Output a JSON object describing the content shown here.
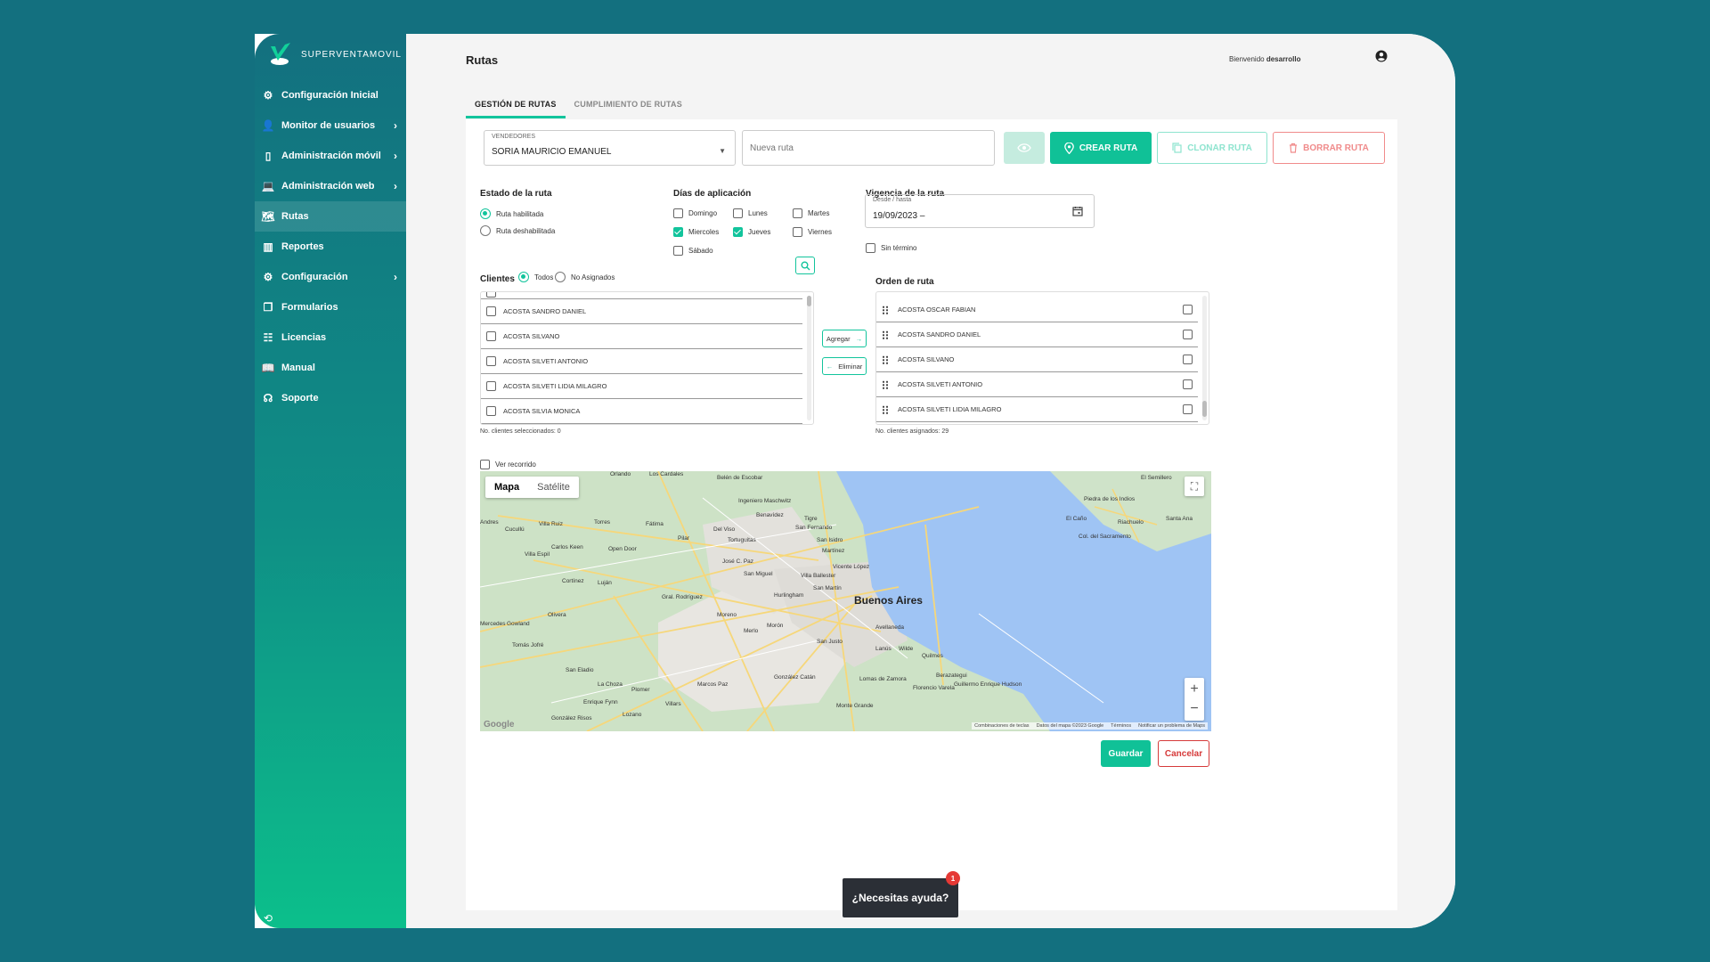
{
  "brand": {
    "name": "SUPERVENTAMOVIL"
  },
  "sidebar": {
    "items": [
      {
        "label": "Configuración Inicial",
        "icon": "gear-icon",
        "chevron": false
      },
      {
        "label": "Monitor de usuarios",
        "icon": "person-icon",
        "chevron": true
      },
      {
        "label": "Administración móvil",
        "icon": "phone-icon",
        "chevron": true
      },
      {
        "label": "Administración web",
        "icon": "laptop-icon",
        "chevron": true
      },
      {
        "label": "Rutas",
        "icon": "map-icon",
        "chevron": false
      },
      {
        "label": "Reportes",
        "icon": "chart-icon",
        "chevron": false
      },
      {
        "label": "Configuración",
        "icon": "gear-icon",
        "chevron": true
      },
      {
        "label": "Formularios",
        "icon": "forms-icon",
        "chevron": false
      },
      {
        "label": "Licencias",
        "icon": "license-icon",
        "chevron": false
      },
      {
        "label": "Manual",
        "icon": "book-icon",
        "chevron": false
      },
      {
        "label": "Soporte",
        "icon": "headset-icon",
        "chevron": false
      }
    ],
    "active": "Rutas"
  },
  "header": {
    "title": "Rutas",
    "welcome_prefix": "Bienvenido",
    "welcome_user": "desarrollo"
  },
  "tabs": [
    {
      "label": "GESTIÓN DE RUTAS",
      "active": true
    },
    {
      "label": "CUMPLIMIENTO DE RUTAS",
      "active": false
    }
  ],
  "form": {
    "seller_label": "VENDEDORES",
    "seller_value": "SORIA MAURICIO EMANUEL",
    "route_name_placeholder": "Nueva ruta",
    "create_label": "CREAR RUTA",
    "clone_label": "CLONAR RUTA",
    "delete_label": "BORRAR RUTA",
    "status_title": "Estado de la ruta",
    "status_enabled": "Ruta habilitada",
    "status_disabled": "Ruta deshabilitada",
    "days_title": "Días de aplicación",
    "days": [
      {
        "label": "Domingo",
        "checked": false
      },
      {
        "label": "Lunes",
        "checked": false
      },
      {
        "label": "Martes",
        "checked": false
      },
      {
        "label": "Miercoles",
        "checked": true
      },
      {
        "label": "Jueves",
        "checked": true
      },
      {
        "label": "Viernes",
        "checked": false
      },
      {
        "label": "Sábado",
        "checked": false
      }
    ],
    "validity_title": "Vigencia de la ruta",
    "date_label": "Desde / hasta",
    "date_value": "19/09/2023 –",
    "no_end_label": "Sin término"
  },
  "clients": {
    "title": "Clientes",
    "filter_all": "Todos",
    "filter_unassigned": "No Asignados",
    "rows": [
      "ACOSTA SANDRO DANIEL",
      "ACOSTA SILVANO",
      "ACOSTA SILVETI ANTONIO",
      "ACOSTA SILVETI LIDIA MILAGRO",
      "ACOSTA SILVIA MONICA"
    ],
    "selected_note": "No. clientes seleccionados: 0"
  },
  "transfer": {
    "add_label": "Agregar",
    "remove_label": "Eliminar"
  },
  "route_order": {
    "title": "Orden de ruta",
    "rows": [
      "ACOSTA OSCAR FABIAN",
      "ACOSTA SANDRO DANIEL",
      "ACOSTA SILVANO",
      "ACOSTA SILVETI ANTONIO",
      "ACOSTA SILVETI LIDIA MILAGRO"
    ],
    "assigned_note": "No. clientes asignados: 29"
  },
  "map": {
    "show_path_label": "Ver recorrido",
    "type_map": "Mapa",
    "type_satellite": "Satélite",
    "main_city": "Buenos Aires",
    "places": [
      "Orlando",
      "Los Cardales",
      "Belén de Escobar",
      "Ingeniero Maschwitz",
      "Benavídez",
      "Villa Ruiz",
      "Torres",
      "Fátima",
      "Del Viso",
      "Tigre",
      "San Fernando",
      "Carlos Keen",
      "Open Door",
      "Pilar",
      "Tortuguitas",
      "San Isidro",
      "Martínez",
      "Villa Espil",
      "José C. Paz",
      "Vicente López",
      "Cortínez",
      "Luján",
      "San Miguel",
      "Villa Ballester",
      "San Martín",
      "Hurlingham",
      "Gral. Rodríguez",
      "Moreno",
      "Olivera",
      "Merlo",
      "Morón",
      "Avellaneda",
      "Tomás Jofré",
      "San Justo",
      "Lanús",
      "Wilde",
      "Quilmes",
      "San Eladio",
      "La Choza",
      "Plomer",
      "Marcos Paz",
      "González Catán",
      "Lomas de Zamora",
      "Berazategui",
      "Florencio Varela",
      "Guillermo Enrique Hudson",
      "Enrique Fynn",
      "Villars",
      "Monte Grande",
      "González Risos",
      "Lozano",
      "El Semillero",
      "Piedra de los Indios",
      "El Caño",
      "Riachuelo",
      "Santa Ana",
      "Col. del Sacramento",
      "Cucullú",
      "Gowland",
      "Andres",
      "Mercedes"
    ],
    "footer": [
      "Combinaciones de teclas",
      "Datos del mapa ©2023 Google",
      "Términos",
      "Notificar un problema de Maps"
    ],
    "google": "Google"
  },
  "actions": {
    "save": "Guardar",
    "cancel": "Cancelar"
  },
  "help": {
    "label": "¿Necesitas ayuda?",
    "badge": "1"
  },
  "colors": {
    "accent": "#10c197",
    "danger": "#d63a3a",
    "background": "#13707f"
  }
}
